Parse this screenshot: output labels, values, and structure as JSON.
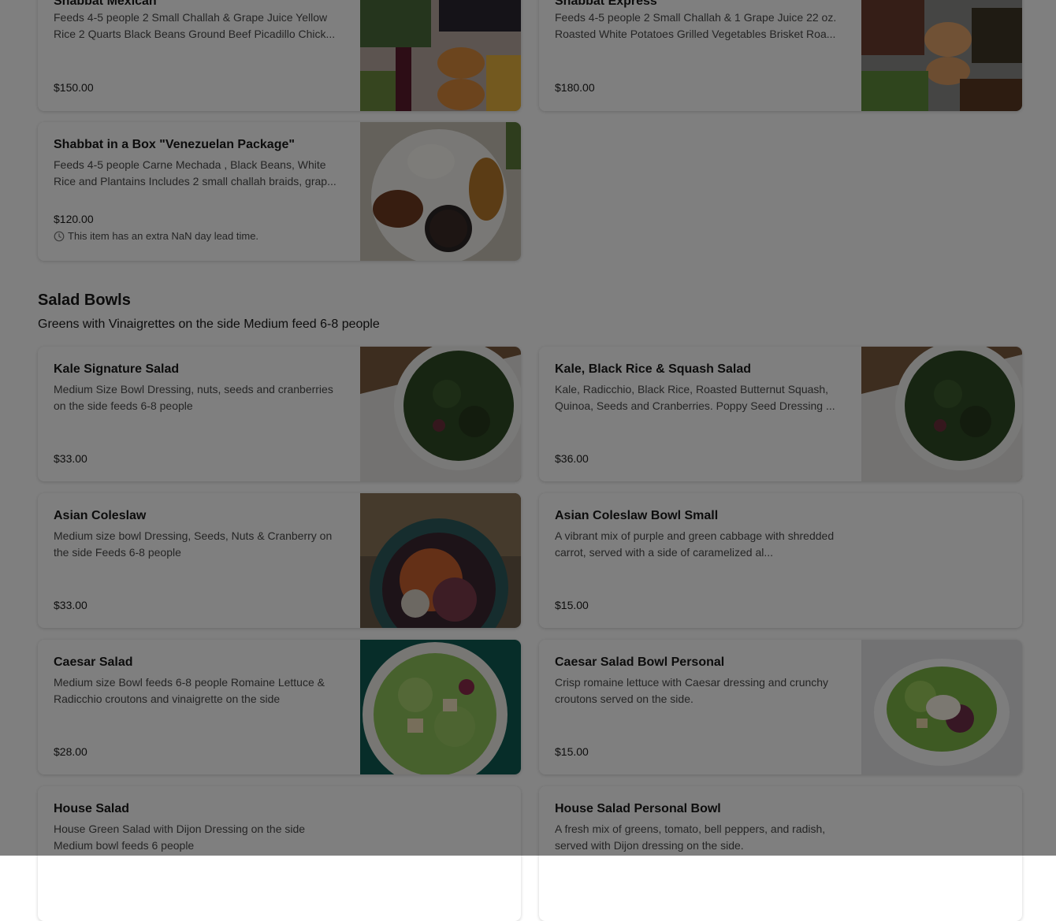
{
  "cards_top": [
    {
      "title": "Shabbat Mexican",
      "description": "Feeds 4-5 people 2 Small Challah & Grape Juice Yellow Rice 2 Quarts Black Beans Ground Beef Picadillo Chick...",
      "price": "$150.00"
    },
    {
      "title": "Shabbat Express",
      "description": "Feeds 4-5 people 2 Small Challah & 1 Grape Juice 22 oz. Roasted White Potatoes Grilled Vegetables Brisket Roa...",
      "price": "$180.00"
    },
    {
      "title": "Shabbat in a Box \"Venezuelan Package\"",
      "description": "Feeds 4-5 people Carne Mechada , Black Beans, White Rice and Plantains Includes 2 small challah braids, grap...",
      "price": "$120.00",
      "lead_time": "This item has an extra NaN day lead time."
    }
  ],
  "section": {
    "title": "Salad Bowls",
    "subtitle": "Greens with Vinaigrettes on the side Medium feed 6-8 people"
  },
  "salads": [
    {
      "title": "Kale Signature Salad",
      "description": "Medium Size Bowl Dressing, nuts, seeds and cranberries on the side feeds 6-8 people",
      "price": "$33.00"
    },
    {
      "title": "Kale, Black Rice & Squash Salad",
      "description": "Kale, Radicchio, Black Rice, Roasted Butternut Squash, Quinoa, Seeds and Cranberries. Poppy Seed Dressing ...",
      "price": "$36.00"
    },
    {
      "title": "Asian Coleslaw",
      "description": "Medium size bowl Dressing, Seeds, Nuts & Cranberry on the side Feeds 6-8 people",
      "price": "$33.00"
    },
    {
      "title": "Asian Coleslaw Bowl Small",
      "description": "A vibrant mix of purple and green cabbage with shredded carrot, served with a side of caramelized al...",
      "price": "$15.00"
    },
    {
      "title": "Caesar Salad",
      "description": "Medium size Bowl feeds 6-8 people Romaine Lettuce & Radicchio croutons and vinaigrette on the side",
      "price": "$28.00"
    },
    {
      "title": "Caesar Salad Bowl Personal",
      "description": "Crisp romaine lettuce with Caesar dressing and crunchy croutons served on the side.",
      "price": "$15.00"
    },
    {
      "title": "House Salad",
      "description": "House Green Salad with Dijon Dressing on the side Medium bowl feeds 6 people"
    },
    {
      "title": "House Salad Personal Bowl",
      "description": "A fresh mix of greens, tomato, bell peppers, and radish, served with Dijon dressing on the side."
    }
  ],
  "icons": {
    "lead_time": "clock-icon"
  },
  "colors": {
    "overlay": "rgba(0,0,0,0.5)",
    "text": "#191919",
    "muted": "#494949"
  }
}
